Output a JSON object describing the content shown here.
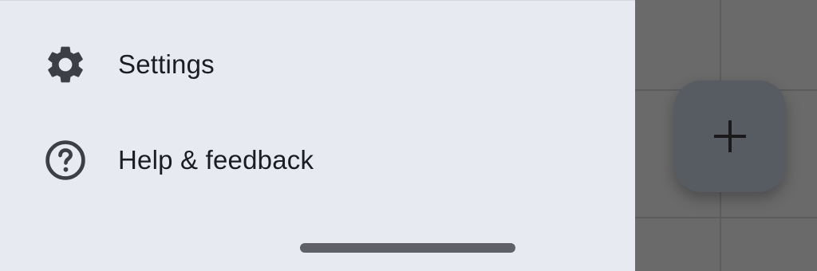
{
  "drawer": {
    "items": [
      {
        "label": "Settings",
        "icon": "gear-icon"
      },
      {
        "label": "Help & feedback",
        "icon": "help-circle-icon"
      }
    ]
  },
  "fab": {
    "icon": "plus-icon"
  },
  "colors": {
    "drawer_background": "#e7eaf1",
    "scrim": "#6a6a6a",
    "fab": "#575c63",
    "text": "#1c1d21",
    "icon": "#3c3f45",
    "home_indicator": "#5f6167"
  }
}
